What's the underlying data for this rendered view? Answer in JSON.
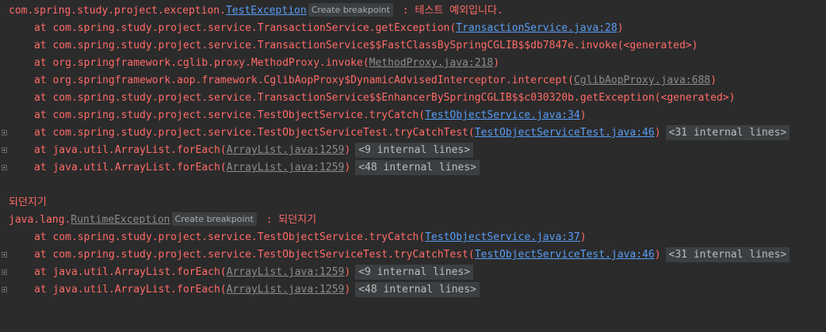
{
  "colors": {
    "background": "#2b2b2b",
    "error_text": "#ff6b68",
    "link_blue": "#589df6",
    "link_gray": "#8c8c8c",
    "badge_bg": "#3c3f41",
    "normal_text": "#d0d0d0"
  },
  "icons": {
    "fold": "plus-square-icon"
  },
  "block1": {
    "exception": {
      "prefix": "com.spring.study.project.exception.",
      "class_name": "TestException",
      "badge": "Create breakpoint",
      "message": " : 테스트 예외입니다."
    },
    "frames": [
      {
        "text": "at com.spring.study.project.service.TransactionService.getException(",
        "link": "TransactionService.java:28",
        "suffix": ")"
      },
      {
        "text": "at com.spring.study.project.service.TransactionService$$FastClassBySpringCGLIB$$db7847e.invoke(<generated>)"
      },
      {
        "text": "at org.springframework.cglib.proxy.MethodProxy.invoke(",
        "link": "MethodProxy.java:218",
        "suffix": ")"
      },
      {
        "text": "at org.springframework.aop.framework.CglibAopProxy$DynamicAdvisedInterceptor.intercept(",
        "link": "CglibAopProxy.java:688",
        "suffix": ")"
      },
      {
        "text": "at com.spring.study.project.service.TransactionService$$EnhancerBySpringCGLIB$$c030320b.getException(<generated>)"
      },
      {
        "text": "at com.spring.study.project.service.TestObjectService.tryCatch(",
        "link": "TestObjectService.java:34",
        "suffix": ")"
      },
      {
        "text": "at com.spring.study.project.service.TestObjectServiceTest.tryCatchTest(",
        "link": "TestObjectServiceTest.java:46",
        "suffix": ")",
        "hidden": "<31 internal lines>"
      },
      {
        "text": "at java.util.ArrayList.forEach(",
        "link": "ArrayList.java:1259",
        "suffix": ")",
        "hidden": "<9 internal lines>"
      },
      {
        "text": "at java.util.ArrayList.forEach(",
        "link": "ArrayList.java:1259",
        "suffix": ")",
        "hidden": "<48 internal lines>"
      }
    ]
  },
  "plain_line": "되던지기",
  "block2": {
    "exception": {
      "prefix": "java.lang.",
      "class_name": "RuntimeException",
      "badge": "Create breakpoint",
      "message": " : 되던지기"
    },
    "frames": [
      {
        "text": "at com.spring.study.project.service.TestObjectService.tryCatch(",
        "link": "TestObjectService.java:37",
        "suffix": ")"
      },
      {
        "text": "at com.spring.study.project.service.TestObjectServiceTest.tryCatchTest(",
        "link": "TestObjectServiceTest.java:46",
        "suffix": ")",
        "hidden": "<31 internal lines>"
      },
      {
        "text": "at java.util.ArrayList.forEach(",
        "link": "ArrayList.java:1259",
        "suffix": ")",
        "hidden": "<9 internal lines>"
      },
      {
        "text": "at java.util.ArrayList.forEach(",
        "link": "ArrayList.java:1259",
        "suffix": ")",
        "hidden": "<48 internal lines>"
      }
    ]
  }
}
